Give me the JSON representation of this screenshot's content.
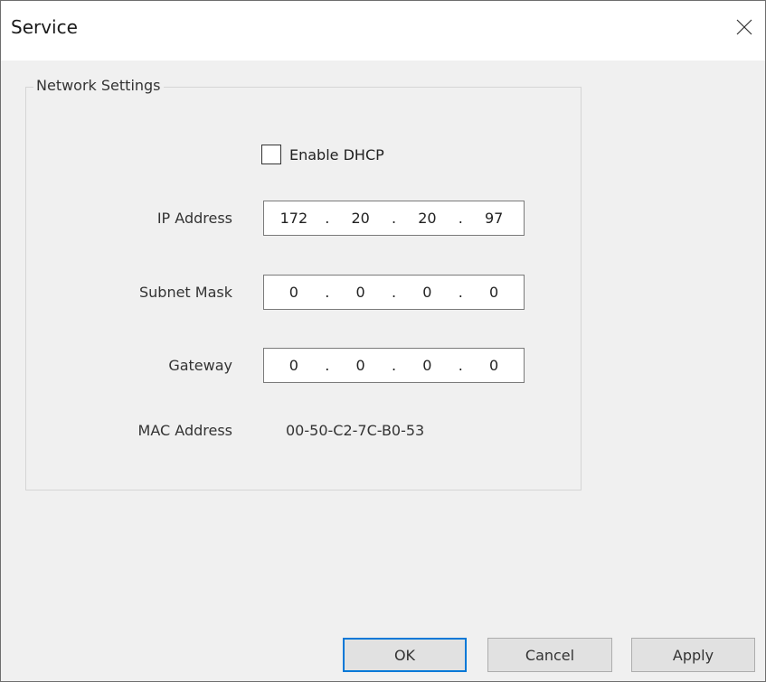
{
  "window": {
    "title": "Service",
    "close_icon": "close-icon"
  },
  "network": {
    "group_label": "Network Settings",
    "dhcp": {
      "label": "Enable DHCP",
      "checked": false
    },
    "ip_address": {
      "label": "IP Address",
      "octets": [
        "172",
        "20",
        "20",
        "97"
      ]
    },
    "subnet_mask": {
      "label": "Subnet Mask",
      "octets": [
        "0",
        "0",
        "0",
        "0"
      ]
    },
    "gateway": {
      "label": "Gateway",
      "octets": [
        "0",
        "0",
        "0",
        "0"
      ]
    },
    "mac_address": {
      "label": "MAC Address",
      "value": "00-50-C2-7C-B0-53"
    }
  },
  "buttons": {
    "ok": "OK",
    "cancel": "Cancel",
    "apply": "Apply"
  },
  "colors": {
    "default_button_border": "#0078d7"
  }
}
